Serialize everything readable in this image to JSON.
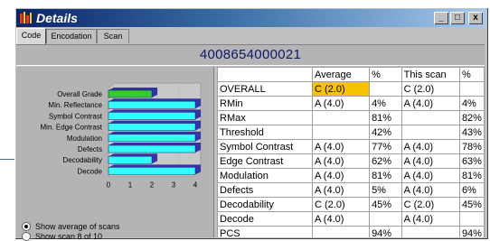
{
  "window": {
    "title": "Details",
    "buttons": {
      "minimize": "_",
      "maximize": "□",
      "close": "x"
    }
  },
  "tabs": [
    {
      "label": "Code"
    },
    {
      "label": "Encodation"
    },
    {
      "label": "Scan"
    }
  ],
  "code_value": "4008654000021",
  "chart_data": {
    "type": "bar",
    "orientation": "horizontal",
    "categories": [
      "Overall Grade",
      "Min. Reflectance",
      "Symbol Contrast",
      "Min. Edge Contrast",
      "Modulation",
      "Defects",
      "Decodability",
      "Decode"
    ],
    "values": [
      2,
      4,
      4,
      4,
      4,
      4,
      2,
      4
    ],
    "xlim": [
      0,
      4
    ],
    "xticks": [
      "0",
      "1",
      "2",
      "3",
      "4"
    ],
    "colors": {
      "overall": "#33cc33",
      "bars": "#33ffff",
      "back": "#3333aa"
    }
  },
  "options": [
    {
      "label": "Show average of scans",
      "selected": true
    },
    {
      "label": "Show scan 8 of 10",
      "selected": false
    }
  ],
  "table": {
    "headers": [
      "",
      "Average",
      "%",
      "This scan",
      "%"
    ],
    "rows": [
      {
        "name": "OVERALL",
        "avg": "C (2.0)",
        "avg_pct": "",
        "scan": "C (2.0)",
        "scan_pct": "",
        "highlight": true
      },
      {
        "name": "RMin",
        "avg": "A (4.0)",
        "avg_pct": "4%",
        "scan": "A (4.0)",
        "scan_pct": "4%"
      },
      {
        "name": "RMax",
        "avg": "",
        "avg_pct": "81%",
        "scan": "",
        "scan_pct": "82%"
      },
      {
        "name": "Threshold",
        "avg": "",
        "avg_pct": "42%",
        "scan": "",
        "scan_pct": "43%"
      },
      {
        "name": "Symbol Contrast",
        "avg": "A (4.0)",
        "avg_pct": "77%",
        "scan": "A (4.0)",
        "scan_pct": "78%"
      },
      {
        "name": "Edge Contrast",
        "avg": "A (4.0)",
        "avg_pct": "62%",
        "scan": "A (4.0)",
        "scan_pct": "63%"
      },
      {
        "name": "Modulation",
        "avg": "A (4.0)",
        "avg_pct": "81%",
        "scan": "A (4.0)",
        "scan_pct": "81%"
      },
      {
        "name": "Defects",
        "avg": "A (4.0)",
        "avg_pct": "5%",
        "scan": "A (4.0)",
        "scan_pct": "6%"
      },
      {
        "name": "Decodability",
        "avg": "C (2.0)",
        "avg_pct": "45%",
        "scan": "C (2.0)",
        "scan_pct": "45%"
      },
      {
        "name": "Decode",
        "avg": "A (4.0)",
        "avg_pct": "",
        "scan": "A (4.0)",
        "scan_pct": ""
      },
      {
        "name": "PCS",
        "avg": "",
        "avg_pct": "94%",
        "scan": "",
        "scan_pct": "94%"
      }
    ]
  }
}
